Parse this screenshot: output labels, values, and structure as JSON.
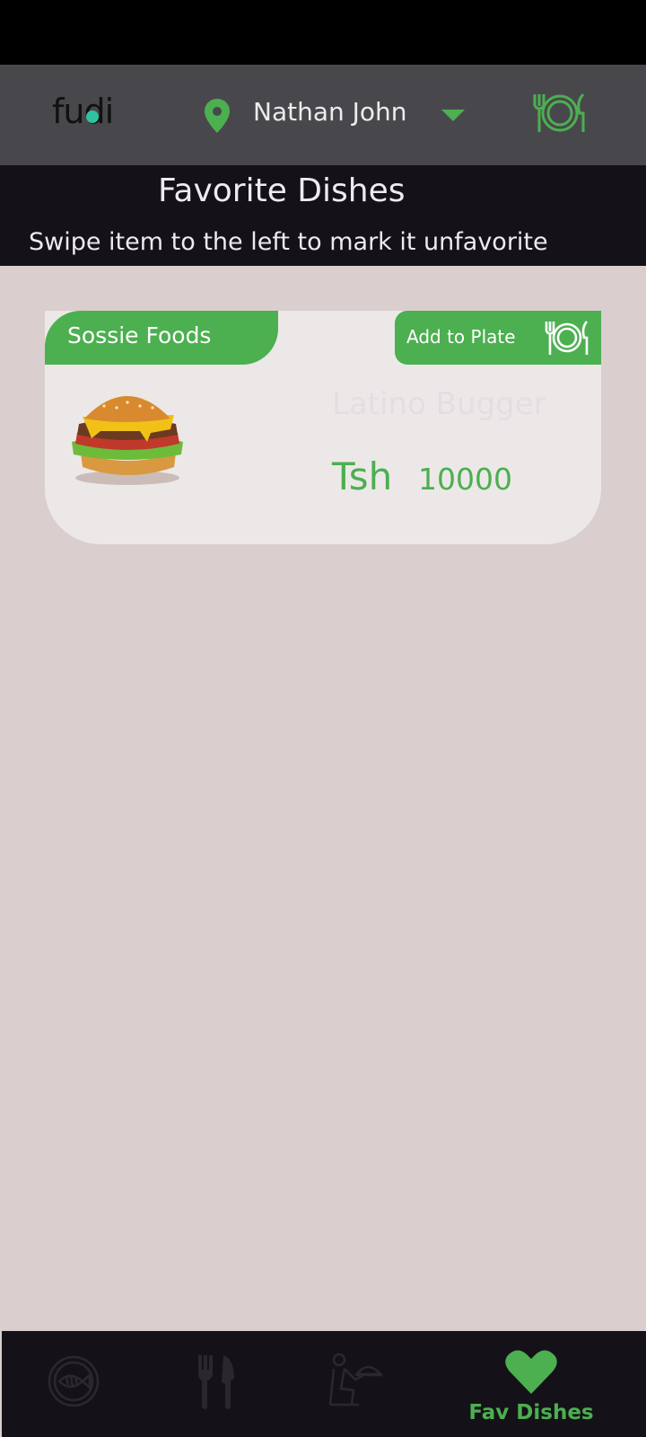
{
  "app": {
    "logo_text": "fudi"
  },
  "appbar": {
    "user_name": "Nathan John"
  },
  "header": {
    "title": "Favorite Dishes",
    "subtitle": "Swipe item to the left to mark it unfavorite"
  },
  "favorites": [
    {
      "vendor": "Sossie Foods",
      "add_label": "Add to Plate",
      "dish_name": "Latino Bugger",
      "currency": "Tsh",
      "price": "10000"
    }
  ],
  "bottom_nav": {
    "items": [
      {
        "icon": "fish-icon",
        "label": ""
      },
      {
        "icon": "cutlery-icon",
        "label": ""
      },
      {
        "icon": "waiter-icon",
        "label": ""
      },
      {
        "icon": "heart-icon",
        "label": "Fav Dishes"
      }
    ]
  },
  "colors": {
    "accent": "#4caf50",
    "appbar": "#48484c",
    "header": "#141218",
    "background": "#dbcece",
    "card": "#ede8e8"
  }
}
